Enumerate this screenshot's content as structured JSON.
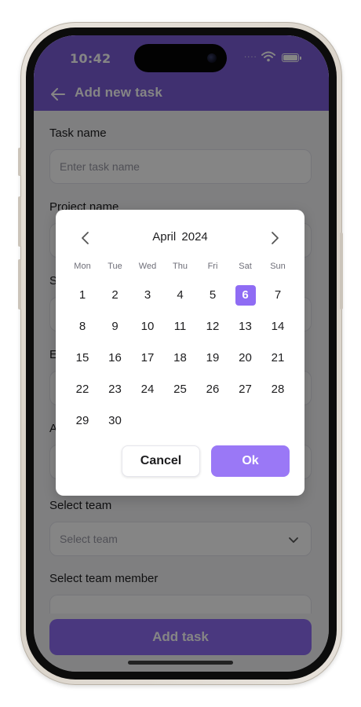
{
  "status_bar": {
    "time": "10:42",
    "signal_dots": "...."
  },
  "header": {
    "title": "Add new task"
  },
  "form": {
    "task_name": {
      "label": "Task name",
      "placeholder": "Enter task name"
    },
    "project_name": {
      "label": "Project name"
    },
    "field_3": {
      "label": "S"
    },
    "field_4": {
      "label": "E"
    },
    "field_5": {
      "label": "A"
    },
    "team": {
      "label": "Select team",
      "placeholder": "Select team"
    },
    "team_member": {
      "label": "Select team member"
    }
  },
  "add_task_label": "Add task",
  "date_picker": {
    "month_label": "April 2024",
    "weekdays": [
      "Mon",
      "Tue",
      "Wed",
      "Thu",
      "Fri",
      "Sat",
      "Sun"
    ],
    "first_weekday_index": 0,
    "days_in_month": 30,
    "selected_day": 6,
    "cancel_label": "Cancel",
    "ok_label": "Ok"
  },
  "colors": {
    "accent": "#7c5cd6",
    "button": "#8f6cf4",
    "selected_day": "#8f6cf4"
  }
}
